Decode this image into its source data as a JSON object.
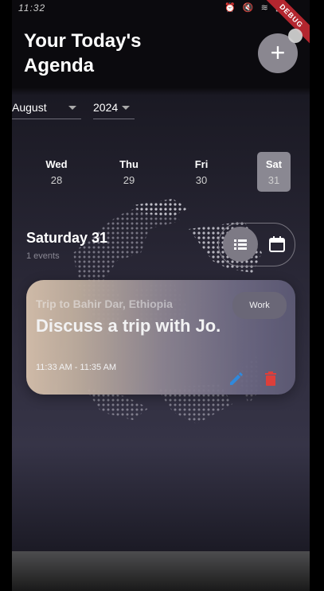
{
  "status_bar": {
    "time": "11:32",
    "icons": "⏰ 🔇 ≋ ▮"
  },
  "debug_banner": "DEBUG",
  "header": {
    "title_line1": "Your Today's",
    "title_line2": "Agenda",
    "add_icon": "+"
  },
  "filters": {
    "month": "August",
    "year": "2024"
  },
  "days": [
    {
      "name": "Wed",
      "date": "28",
      "selected": false
    },
    {
      "name": "Thu",
      "date": "29",
      "selected": false
    },
    {
      "name": "Fri",
      "date": "30",
      "selected": false
    },
    {
      "name": "Sat",
      "date": "31",
      "selected": true
    }
  ],
  "agenda": {
    "date_title": "Saturday 31",
    "event_count": "1 events"
  },
  "view_toggle": {
    "list_icon": "list-icon",
    "calendar_icon": "calendar-icon"
  },
  "event": {
    "subtitle": "Trip to Bahir Dar, Ethiopia",
    "title": "Discuss a trip with Jo.",
    "time": "11:33 AM - 11:35 AM",
    "category": "Work"
  },
  "colors": {
    "edit_icon": "#2f8fe6",
    "delete_icon": "#e8403a",
    "selected_day": "#8a8892"
  }
}
